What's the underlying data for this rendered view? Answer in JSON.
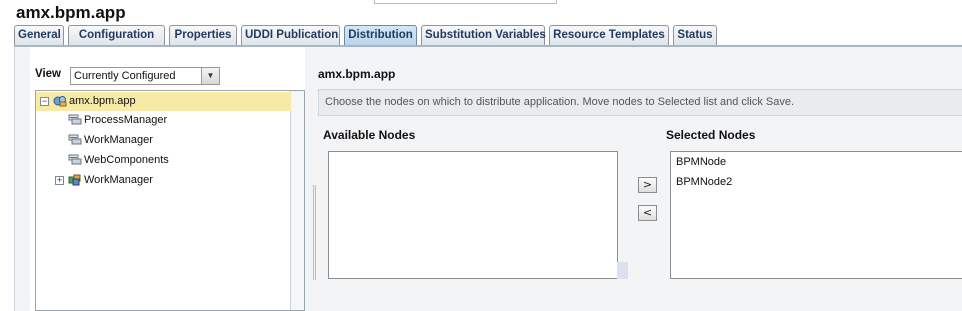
{
  "app": {
    "title": "amx.bpm.app"
  },
  "tabs": [
    {
      "label": "General",
      "active": false
    },
    {
      "label": "Configuration",
      "active": false
    },
    {
      "label": "Properties",
      "active": false
    },
    {
      "label": "UDDI Publication",
      "active": false
    },
    {
      "label": "Distribution",
      "active": true
    },
    {
      "label": "Substitution Variables",
      "active": false
    },
    {
      "label": "Resource Templates",
      "active": false
    },
    {
      "label": "Status",
      "active": false
    }
  ],
  "view": {
    "label": "View",
    "selected": "Currently Configured"
  },
  "tree": {
    "items": [
      {
        "label": "amx.bpm.app",
        "toggle": "−",
        "icon": "application-icon",
        "selected": true
      },
      {
        "label": "ProcessManager",
        "toggle": "",
        "icon": "component-icon",
        "selected": false
      },
      {
        "label": "WorkManager",
        "toggle": "",
        "icon": "component-icon",
        "selected": false
      },
      {
        "label": "WebComponents",
        "toggle": "",
        "icon": "component-icon",
        "selected": false
      },
      {
        "label": "WorkManager",
        "toggle": "+",
        "icon": "package-icon",
        "selected": false
      }
    ]
  },
  "distribution": {
    "app_name": "amx.bpm.app",
    "instruction": "Choose the nodes on which to distribute application. Move nodes to Selected list and click Save.",
    "available_heading": "Available Nodes",
    "selected_heading": "Selected Nodes",
    "available_nodes": [],
    "selected_nodes": [
      "BPMNode",
      "BPMNode2"
    ],
    "move_right_label": ">",
    "move_left_label": "<"
  },
  "colors": {
    "active_tab": "#b8d2ec",
    "tab_text": "#1f3a5c",
    "selected_tree_row": "#f7e9a6",
    "instruction_bar": "#e9ebee"
  }
}
